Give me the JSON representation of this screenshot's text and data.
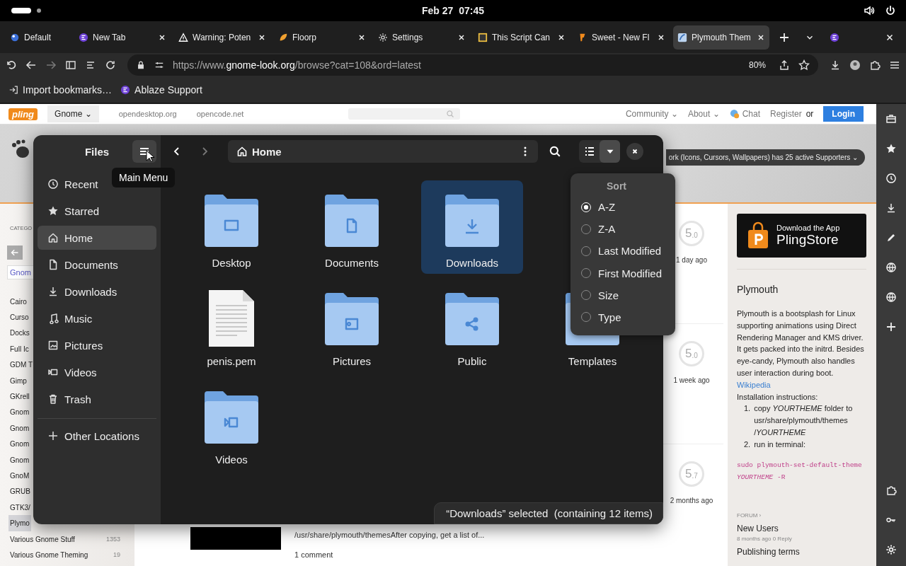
{
  "top_bar": {
    "date": "Feb 27",
    "time": "07:45"
  },
  "browser": {
    "tabs": [
      {
        "kind": "container",
        "title": "Default",
        "selected": false
      },
      {
        "kind": "ablaze",
        "title": "New Tab",
        "selected": false
      },
      {
        "kind": "warning",
        "title": "Warning: Poten",
        "selected": false
      },
      {
        "kind": "floorp",
        "title": "Floorp",
        "selected": false
      },
      {
        "kind": "gear",
        "title": "Settings",
        "selected": false
      },
      {
        "kind": "script",
        "title": "This Script Can",
        "selected": false
      },
      {
        "kind": "pling",
        "title": "Sweet - New Fl",
        "selected": false
      },
      {
        "kind": "plymouth",
        "title": "Plymouth Them",
        "selected": true
      }
    ],
    "url": {
      "prefix": "https://www.",
      "domain": "gnome-look.org",
      "path": "/browse?cat=108&ord=latest"
    },
    "zoom": "80%",
    "bookmarks": [
      {
        "kind": "import",
        "label": "Import bookmarks…"
      },
      {
        "kind": "ablaze",
        "label": "Ablaze Support"
      }
    ]
  },
  "page": {
    "logo": "pling",
    "store": "Gnome ⌄",
    "links": [
      "opendesktop.org",
      "opencode.net"
    ],
    "nav": [
      "Community ⌄",
      "About ⌄"
    ],
    "chat": "Chat",
    "register": "Register",
    "or": "or",
    "login": "Login",
    "supporters": "ork (Icons, Cursors, Wallpapers) has 25 active Supporters ⌄",
    "categories_label": "CATEGO",
    "current_category": "Gnom",
    "categories": [
      {
        "label": "Cairo",
        "selected": false
      },
      {
        "label": "Curso",
        "selected": false
      },
      {
        "label": "Docks",
        "selected": false
      },
      {
        "label": "Full Ic",
        "selected": false
      },
      {
        "label": "GDM T",
        "selected": false
      },
      {
        "label": "Gimp",
        "selected": false
      },
      {
        "label": "GKrell",
        "selected": false
      },
      {
        "label": "Gnom",
        "selected": false
      },
      {
        "label": "Gnom",
        "selected": false
      },
      {
        "label": "Gnom",
        "selected": false
      },
      {
        "label": "Gnom",
        "selected": false
      },
      {
        "label": "GnoM",
        "selected": false
      },
      {
        "label": "GRUB",
        "selected": false
      },
      {
        "label": "GTK3/",
        "selected": false
      },
      {
        "label": "Plymo",
        "selected": true
      },
      {
        "label": "Various Gnome Stuff",
        "count": "1353",
        "selected": false
      },
      {
        "label": "Various Gnome Theming",
        "count": "19",
        "selected": false
      }
    ],
    "ratings": [
      {
        "score": "5.0",
        "age": "1 day ago"
      },
      {
        "score": "5.0",
        "age": "1 week ago"
      },
      {
        "score": "5.7",
        "age": "2 months ago"
      }
    ],
    "snippet": "/usr/share/plymouth/themesAfter copying, get a list of...",
    "comments": "1 comment",
    "badge": {
      "line1": "Download the App",
      "line2": "PlingStore"
    },
    "about": {
      "title": "Plymouth",
      "text": "Plymouth is a bootsplash for Linux supporting animations using Direct Rendering Manager and KMS driver. It gets packed into the initrd. Besides eye-candy, Plymouth also handles user interaction during boot.",
      "link": "Wikipedia",
      "install": "Installation instructions:",
      "steps": [
        {
          "marker": "1.",
          "text": "copy *YOURTHEME* folder to usr/share/plymouth/themes /*YOURTHEME*"
        },
        {
          "marker": "2.",
          "text": "run in terminal:"
        }
      ],
      "code": [
        "sudo plymouth-set-default-theme",
        "*YOURTHEME* -R"
      ]
    },
    "forum": {
      "label": "FORUM ›",
      "posts": [
        {
          "title": "New Users",
          "meta": "8 months ago  0 Reply"
        },
        {
          "title": "Publishing terms"
        }
      ]
    }
  },
  "files": {
    "title": "Files",
    "tooltip": "Main Menu",
    "location": "Home",
    "sidebar": [
      {
        "kind": "recent",
        "label": "Recent",
        "selected": false
      },
      {
        "kind": "starred",
        "label": "Starred",
        "selected": false
      },
      {
        "kind": "home",
        "label": "Home",
        "selected": true
      },
      {
        "kind": "documents",
        "label": "Documents",
        "selected": false
      },
      {
        "kind": "downloads",
        "label": "Downloads",
        "selected": false
      },
      {
        "kind": "music",
        "label": "Music",
        "selected": false
      },
      {
        "kind": "pictures",
        "label": "Pictures",
        "selected": false
      },
      {
        "kind": "videos",
        "label": "Videos",
        "selected": false
      },
      {
        "kind": "trash",
        "label": "Trash",
        "selected": false
      },
      {
        "kind": "other",
        "label": "Other Locations",
        "selected": false
      }
    ],
    "rows": [
      [
        {
          "kind": "desktop",
          "name": "Desktop",
          "selected": false
        },
        {
          "kind": "documents",
          "name": "Documents",
          "selected": false
        },
        {
          "kind": "downloads",
          "name": "Downloads",
          "selected": true
        }
      ],
      [
        {
          "kind": "file",
          "name": "penis.pem",
          "selected": false
        },
        {
          "kind": "pictures",
          "name": "Pictures",
          "selected": false
        },
        {
          "kind": "public",
          "name": "Public",
          "selected": false
        },
        {
          "kind": "templates",
          "name": "Templates",
          "selected": false
        }
      ],
      [
        {
          "kind": "videos",
          "name": "Videos",
          "selected": false
        }
      ]
    ],
    "sort": {
      "title": "Sort",
      "options": [
        {
          "label": "A-Z",
          "selected": true
        },
        {
          "label": "Z-A",
          "selected": false
        },
        {
          "label": "Last Modified",
          "selected": false
        },
        {
          "label": "First Modified",
          "selected": false
        },
        {
          "label": "Size",
          "selected": false
        },
        {
          "label": "Type",
          "selected": false
        }
      ]
    },
    "status": "“Downloads” selected  (containing 12 items)"
  }
}
